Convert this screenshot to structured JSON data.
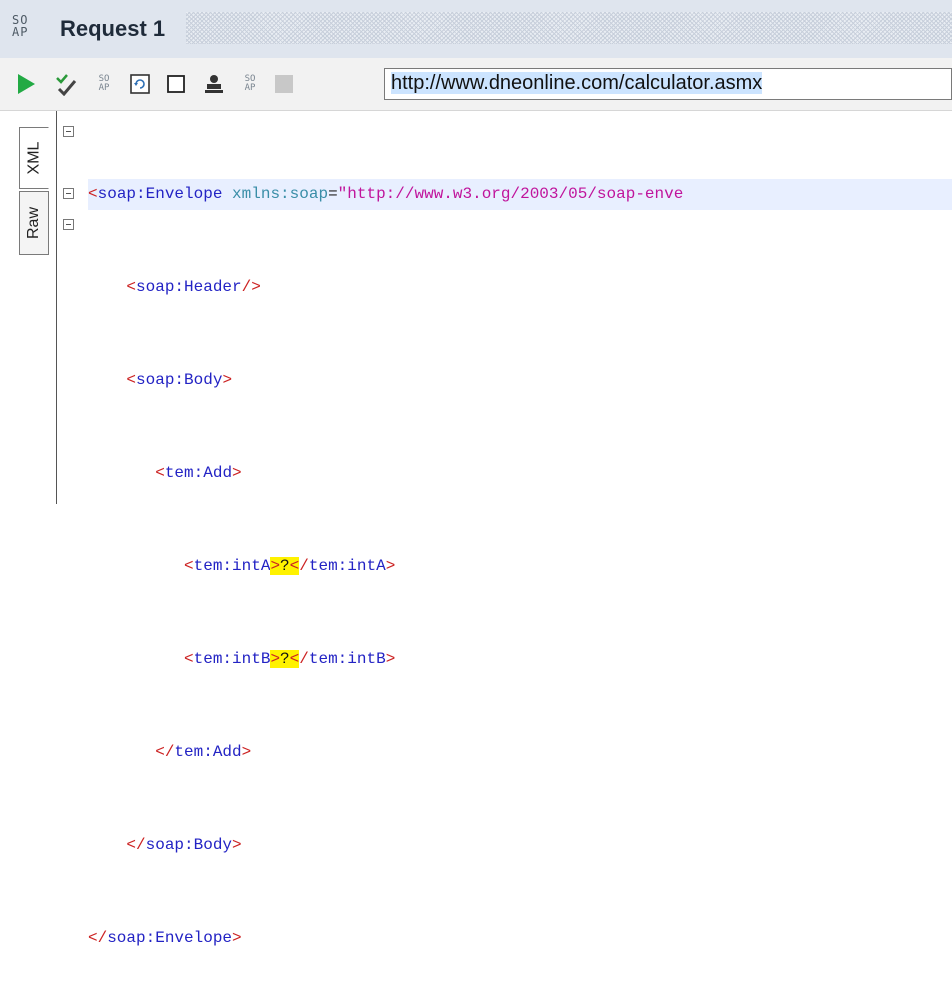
{
  "title": {
    "logo_text": "SO AP",
    "label": "Request 1"
  },
  "toolbar": {
    "buttons": [
      {
        "name": "submit-request",
        "icon": "play-icon"
      },
      {
        "name": "validate",
        "icon": "check-icon"
      },
      {
        "name": "soap-action-1",
        "icon": "soap-icon"
      },
      {
        "name": "reload",
        "icon": "refresh-icon"
      },
      {
        "name": "toggle-panel",
        "icon": "square-icon"
      },
      {
        "name": "user-auth",
        "icon": "user-icon"
      },
      {
        "name": "soap-action-2",
        "icon": "soap-icon"
      },
      {
        "name": "stop",
        "icon": "stop-icon"
      }
    ],
    "url": "http://www.dneonline.com/calculator.asmx"
  },
  "tabs": {
    "xml": "XML",
    "raw": "Raw"
  },
  "code": {
    "l1_tag": "soap:Envelope",
    "l1_attr": "xmlns:soap",
    "l1_val": "\"http://www.w3.org/2003/05/soap-enve",
    "l2_tag": "soap:Header",
    "l3_tag": "soap:Body",
    "l4_tag": "tem:Add",
    "l5_tag": "tem:intA",
    "l5_val": "?",
    "l6_tag": "tem:intB",
    "l6_val": "?",
    "l7_tag": "tem:Add",
    "l8_tag": "soap:Body",
    "l9_tag": "soap:Envelope"
  },
  "colors": {
    "tag": "#2323c4",
    "bracket": "#cc2222",
    "attribute": "#3a8ea8",
    "string": "#c0149c",
    "highlight": "#fff200",
    "play": "#22aa44"
  }
}
